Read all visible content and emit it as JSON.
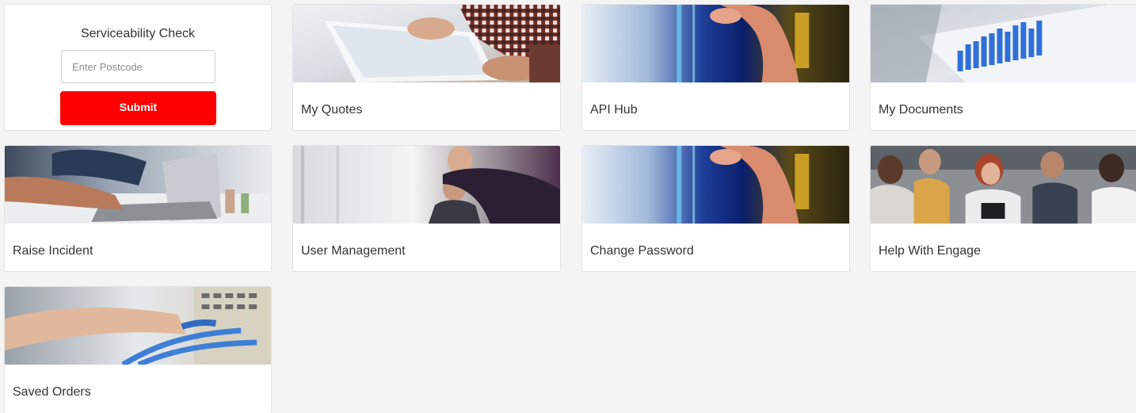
{
  "serviceability": {
    "title": "Serviceability Check",
    "placeholder": "Enter Postcode",
    "value": "",
    "submit_label": "Submit"
  },
  "tiles": [
    {
      "label": "My Quotes",
      "image": "tablet-hands-image"
    },
    {
      "label": "API Hub",
      "image": "touchscreen-finger-image"
    },
    {
      "label": "My Documents",
      "image": "bar-chart-screen-image"
    },
    {
      "label": "Raise Incident",
      "image": "laptop-typing-image"
    },
    {
      "label": "User Management",
      "image": "office-meeting-image"
    },
    {
      "label": "Change Password",
      "image": "touchscreen-finger-image"
    },
    {
      "label": "Help With Engage",
      "image": "team-group-image"
    },
    {
      "label": "Saved Orders",
      "image": "network-cables-image"
    }
  ],
  "colors": {
    "accent": "#ff0000",
    "page_background": "#f4f4f4",
    "card_background": "#ffffff",
    "text": "#333333"
  }
}
